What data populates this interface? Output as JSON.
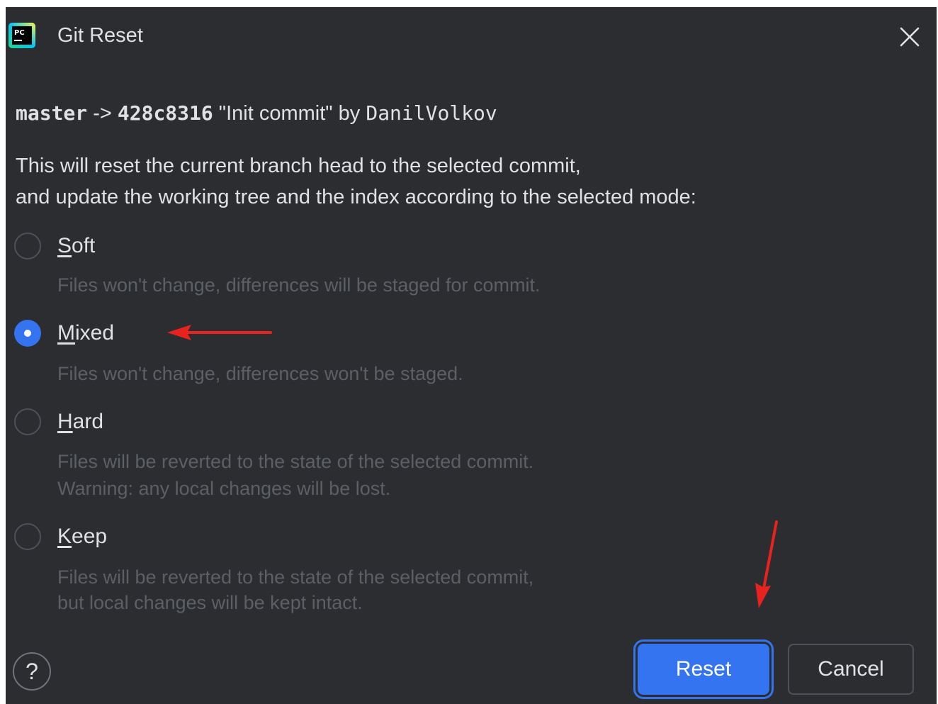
{
  "dialog": {
    "title": "Git Reset",
    "app_icon": "pycharm-logo-icon",
    "close_icon": "close-icon"
  },
  "commit": {
    "branch": "master",
    "arrow": "->",
    "hash": "428c8316",
    "message": "\"Init commit\"",
    "by": "by",
    "author": "DanilVolkov"
  },
  "description": {
    "line1": "This will reset the current branch head to the selected commit,",
    "line2": "and update the working tree and the index according to the selected mode:"
  },
  "options": [
    {
      "mnemonic": "S",
      "rest": "oft",
      "selected": false,
      "hint_lines": [
        "Files won't change, differences will be staged for commit."
      ]
    },
    {
      "mnemonic": "M",
      "rest": "ixed",
      "selected": true,
      "hint_lines": [
        "Files won't change, differences won't be staged."
      ]
    },
    {
      "mnemonic": "H",
      "rest": "ard",
      "selected": false,
      "hint_lines": [
        "Files will be reverted to the state of the selected commit.",
        "Warning: any local changes will be lost."
      ]
    },
    {
      "mnemonic": "K",
      "rest": "eep",
      "selected": false,
      "hint_lines": [
        "Files will be reverted to the state of the selected commit,",
        "but local changes will be kept intact."
      ]
    }
  ],
  "footer": {
    "help_label": "?",
    "reset_label": "Reset",
    "cancel_label": "Cancel"
  },
  "colors": {
    "background": "#2b2d30",
    "accent": "#3574f0",
    "text": "#dfe1e5",
    "hint_text": "#5c5f65",
    "annotation_arrow": "#e8231f"
  }
}
